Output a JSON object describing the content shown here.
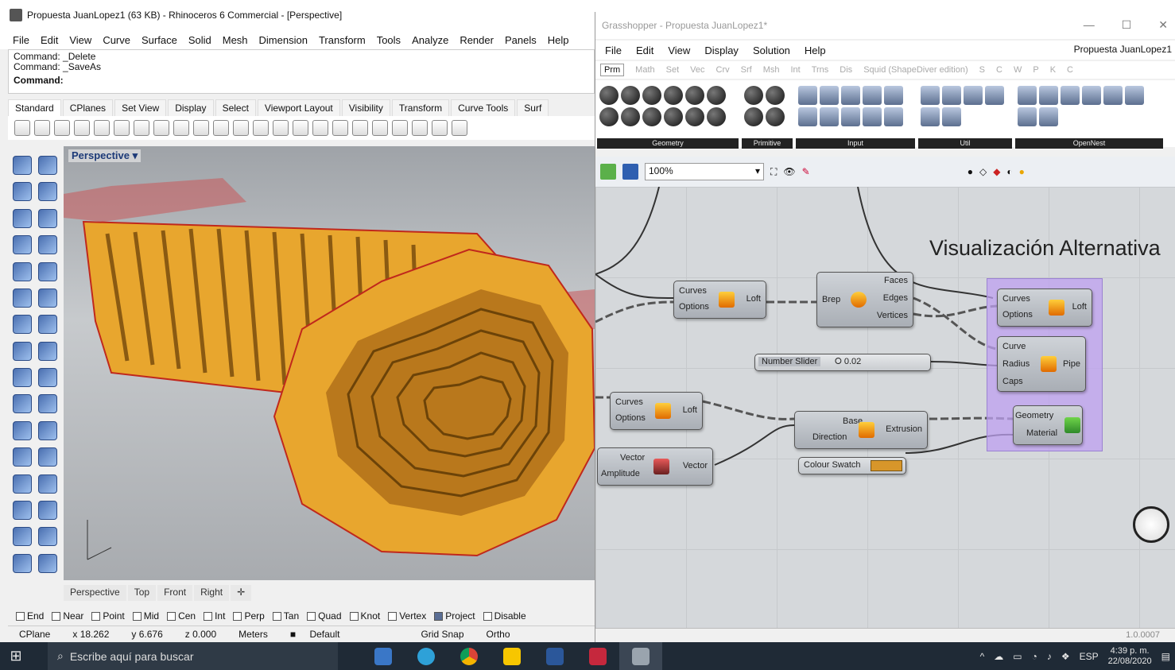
{
  "rhino": {
    "title": "Propuesta JuanLopez1 (63 KB) - Rhinoceros 6 Commercial - [Perspective]",
    "menu": [
      "File",
      "Edit",
      "View",
      "Curve",
      "Surface",
      "Solid",
      "Mesh",
      "Dimension",
      "Transform",
      "Tools",
      "Analyze",
      "Render",
      "Panels",
      "Help"
    ],
    "command_history": [
      "Command: _Delete",
      "Command: _SaveAs"
    ],
    "command_prompt": "Command:",
    "toolbar_tabs": [
      "Standard",
      "CPlanes",
      "Set View",
      "Display",
      "Select",
      "Viewport Layout",
      "Visibility",
      "Transform",
      "Curve Tools",
      "Surf"
    ],
    "viewport_name": "Perspective",
    "viewport_tabs": [
      "Perspective",
      "Top",
      "Front",
      "Right"
    ],
    "osnaps": [
      {
        "label": "End",
        "checked": false
      },
      {
        "label": "Near",
        "checked": false
      },
      {
        "label": "Point",
        "checked": false
      },
      {
        "label": "Mid",
        "checked": false
      },
      {
        "label": "Cen",
        "checked": false
      },
      {
        "label": "Int",
        "checked": false
      },
      {
        "label": "Perp",
        "checked": false
      },
      {
        "label": "Tan",
        "checked": false
      },
      {
        "label": "Quad",
        "checked": false
      },
      {
        "label": "Knot",
        "checked": false
      },
      {
        "label": "Vertex",
        "checked": false
      },
      {
        "label": "Project",
        "checked": true
      },
      {
        "label": "Disable",
        "checked": false
      }
    ],
    "status": {
      "cplane": "CPlane",
      "x": "x 18.262",
      "y": "y 6.676",
      "z": "z 0.000",
      "units": "Meters",
      "layer": "Default",
      "grid_snap": "Grid Snap",
      "ortho": "Ortho"
    }
  },
  "grasshopper": {
    "title": "Grasshopper - Propuesta JuanLopez1*",
    "menu": [
      "File",
      "Edit",
      "View",
      "Display",
      "Solution",
      "Help"
    ],
    "document_name": "Propuesta JuanLopez1",
    "tabs": [
      "Prm",
      "Math",
      "Set",
      "Vec",
      "Crv",
      "Srf",
      "Msh",
      "Int",
      "Trns",
      "Dis",
      "Squid (ShapeDiver edition)",
      "S",
      "C",
      "W",
      "P",
      "K",
      "C"
    ],
    "panel_groups": [
      "Geometry",
      "Primitive",
      "Input",
      "Util",
      "OpenNest"
    ],
    "zoom": "100%",
    "canvas_label": "Visualización Alternativa",
    "components": {
      "loft1": {
        "inputs": [
          "Curves",
          "Options"
        ],
        "name": "Loft"
      },
      "brep": {
        "input": "Brep",
        "outputs": [
          "Faces",
          "Edges",
          "Vertices"
        ]
      },
      "loft2": {
        "inputs": [
          "Curves",
          "Options"
        ],
        "name": "Loft"
      },
      "loft3": {
        "inputs": [
          "Curves",
          "Options"
        ],
        "name": "Loft"
      },
      "slider": {
        "label": "Number Slider",
        "value": "0.02"
      },
      "pipe": {
        "inputs": [
          "Curve",
          "Radius",
          "Caps"
        ],
        "name": "Pipe"
      },
      "extrusion": {
        "inputs": [
          "Base",
          "Direction"
        ],
        "name": "Extrusion"
      },
      "vector": {
        "inputs": [
          "Vector",
          "Amplitude"
        ],
        "name": "Vector"
      },
      "swatch": {
        "label": "Colour Swatch",
        "color": "#d8962a"
      },
      "preview": {
        "inputs": [
          "Geometry",
          "Material"
        ]
      }
    },
    "status_right": "1.0.0007"
  },
  "taskbar": {
    "search_placeholder": "Escribe aquí para buscar",
    "lang": "ESP",
    "time": "4:39 p. m.",
    "date": "22/08/2020"
  },
  "colors": {
    "tube": "#e8a62e",
    "tube_edge": "#c0281c",
    "group": "#c6a4f2"
  }
}
